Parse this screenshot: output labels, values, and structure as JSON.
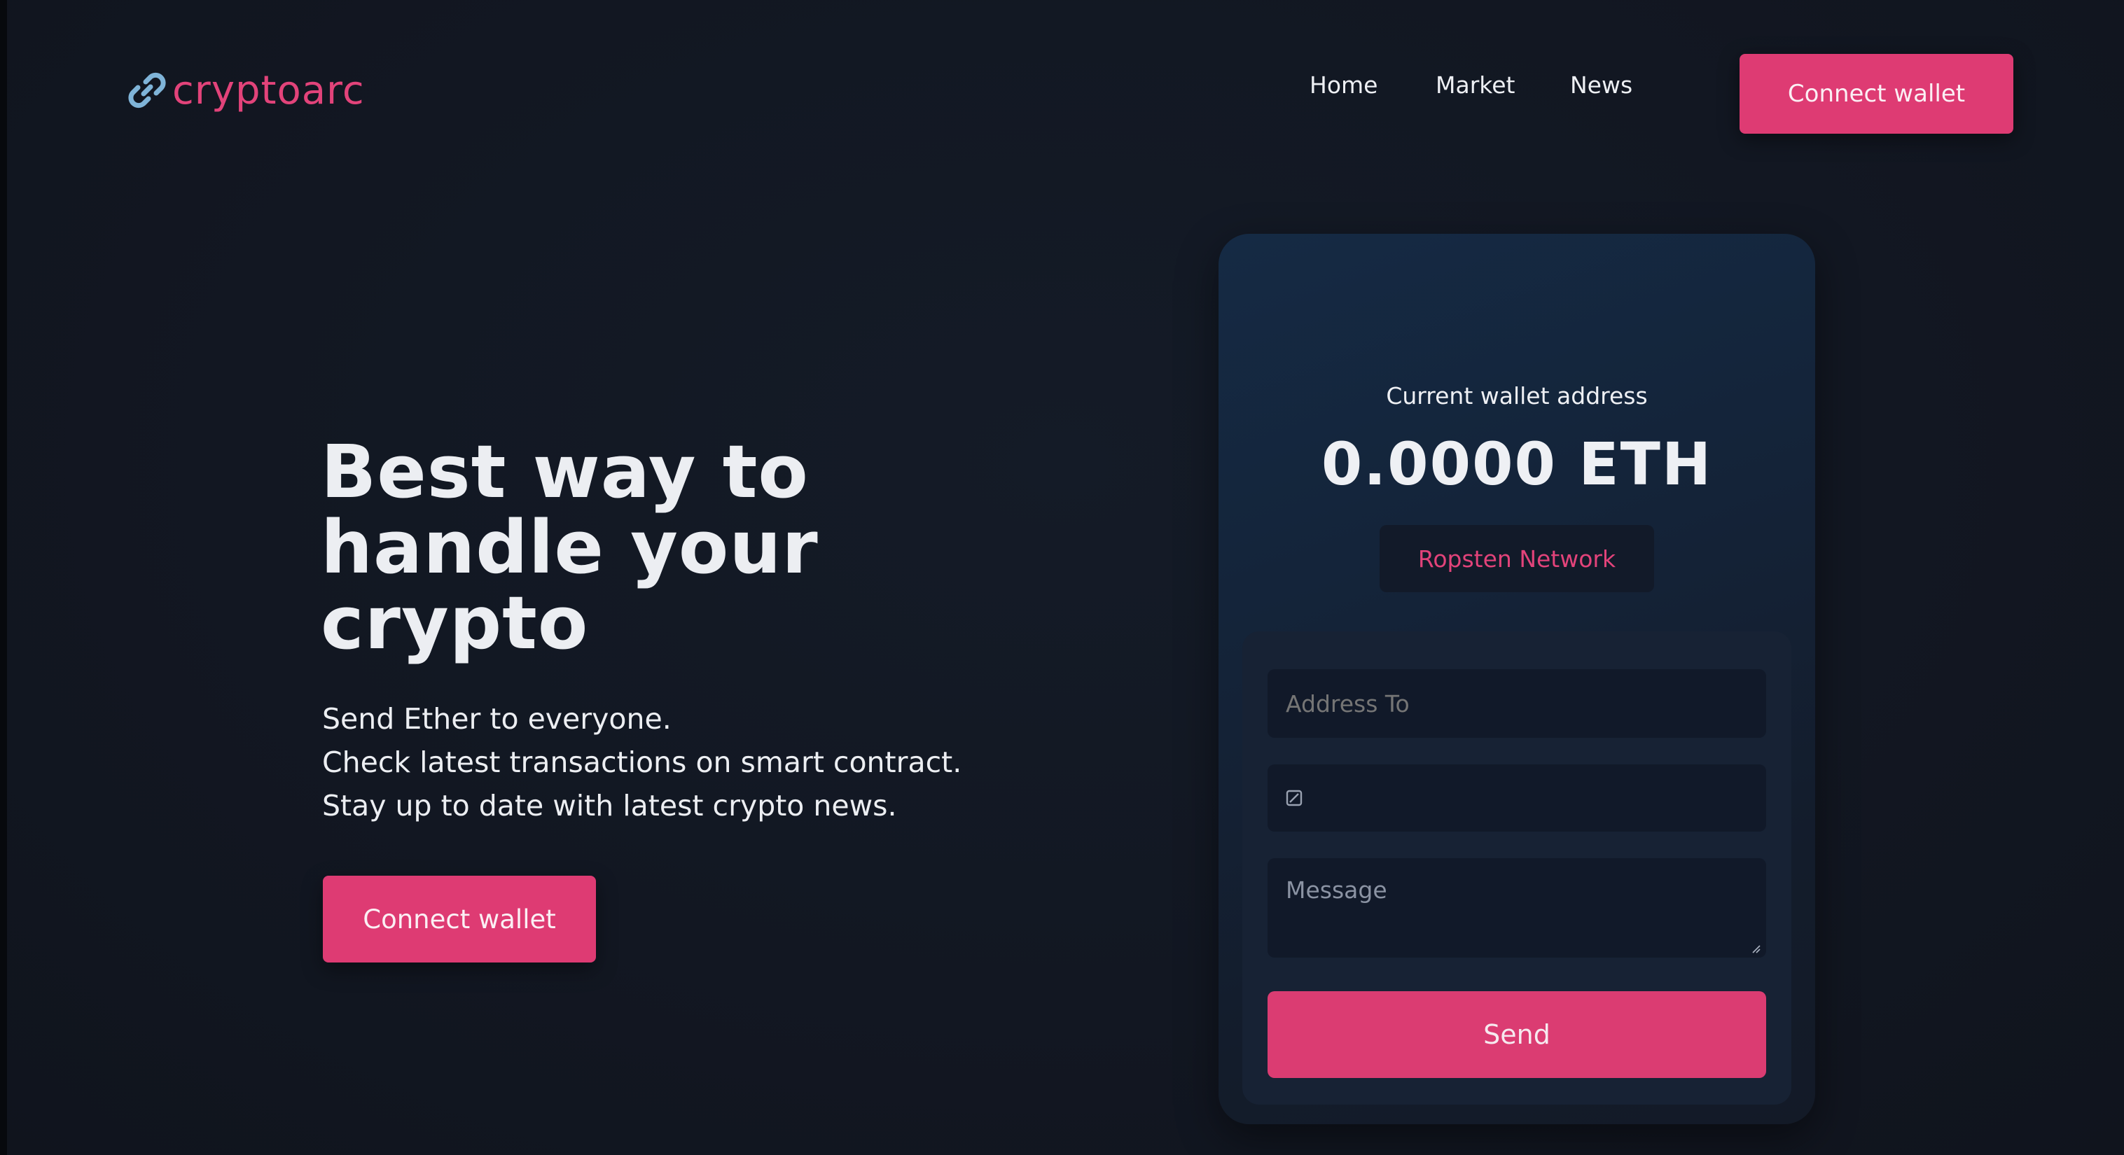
{
  "brand": {
    "name": "cryptoarc",
    "logo_icon": "link-chain-icon",
    "colors": {
      "accent": "#de3b73",
      "logo_icon": "#7fb4d8",
      "background": "#121722",
      "card": "#142338"
    }
  },
  "nav": {
    "items": [
      {
        "label": "Home"
      },
      {
        "label": "Market"
      },
      {
        "label": "News"
      }
    ],
    "connect_label": "Connect wallet"
  },
  "hero": {
    "title": "Best way to handle your crypto",
    "lines": [
      "Send Ether to everyone.",
      "Check latest transactions on smart contract.",
      "Stay up to date with latest crypto news."
    ],
    "connect_label": "Connect wallet"
  },
  "wallet": {
    "label": "Current wallet address",
    "balance": "0.0000 ETH",
    "network": "Ropsten Network"
  },
  "form": {
    "address_placeholder": "Address To",
    "amount_icon": "number-input-icon",
    "message_placeholder": "Message",
    "send_label": "Send"
  }
}
